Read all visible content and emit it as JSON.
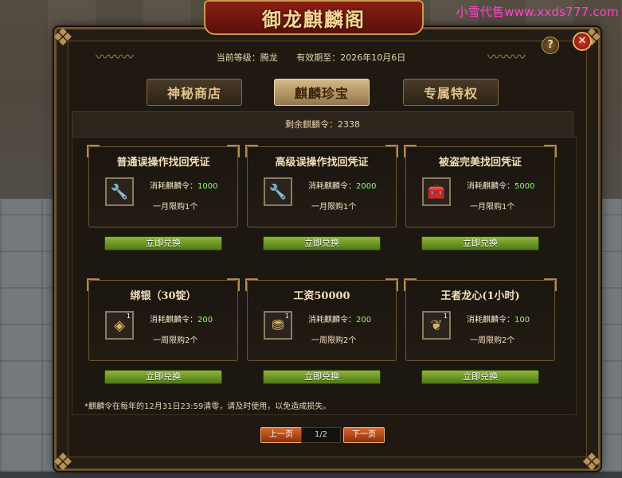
{
  "watermark": "小雪代售www.xxds777.com",
  "panel": {
    "title": "御龙麒麟阁",
    "help_label": "?",
    "close_label": "✕",
    "current_level_label": "当前等级：腾龙",
    "expiry_label": "有效期至：2026年10月6日"
  },
  "tabs": [
    {
      "label": "神秘商店",
      "active": false
    },
    {
      "label": "麒麟珍宝",
      "active": true
    },
    {
      "label": "专属特权",
      "active": false
    }
  ],
  "remaining": "剩余麒麟令：2338",
  "cost_prefix": "消耗麒麟令：",
  "redeem_label": "立即兑换",
  "items": [
    {
      "title": "普通误操作找回凭证",
      "icon": "wrench-scroll-icon",
      "glyph": "🔧",
      "qty": "",
      "cost": "1000",
      "limit": "一月限购1个"
    },
    {
      "title": "高级误操作找回凭证",
      "icon": "wrench-scroll-icon",
      "glyph": "🔧",
      "qty": "",
      "cost": "2000",
      "limit": "一月限购1个"
    },
    {
      "title": "被盗完美找回凭证",
      "icon": "treasure-chest-icon",
      "glyph": "🧰",
      "qty": "",
      "cost": "5000",
      "limit": "一月限购1个"
    },
    {
      "title": "绑银（30锭）",
      "icon": "silver-ingot-icon",
      "glyph": "◈",
      "qty": "1",
      "cost": "200",
      "limit": "一周限购2个"
    },
    {
      "title": "工资50000",
      "icon": "gold-coins-icon",
      "glyph": "⛃",
      "qty": "1",
      "cost": "200",
      "limit": "一周限购2个"
    },
    {
      "title": "王者龙心(1小时)",
      "icon": "dragon-heart-icon",
      "glyph": "❦",
      "qty": "1",
      "cost": "100",
      "limit": "一周限购2个"
    }
  ],
  "note": "*麒麟令在每年的12月31日23:59清零，请及时使用，以免造成损失。",
  "pager": {
    "prev": "上一页",
    "page": "1/2",
    "next": "下一页"
  }
}
